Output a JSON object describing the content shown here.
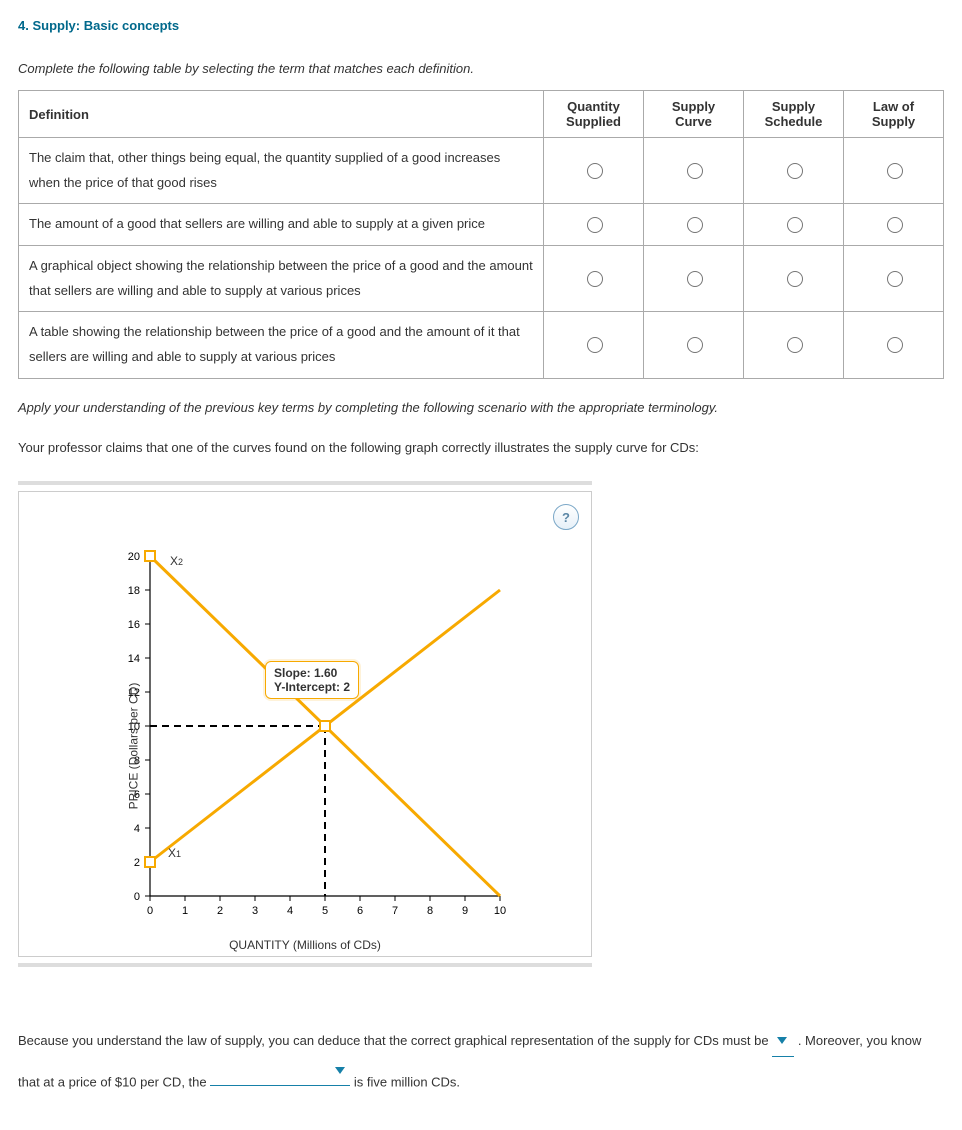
{
  "title": "4. Supply: Basic concepts",
  "instruction1": "Complete the following table by selecting the term that matches each definition.",
  "table": {
    "head_def": "Definition",
    "options": [
      "Quantity Supplied",
      "Supply Curve",
      "Supply Schedule",
      "Law of Supply"
    ],
    "rows": [
      "The claim that, other things being equal, the quantity supplied of a good increases when the price of that good rises",
      "The amount of a good that sellers are willing and able to supply at a given price",
      "A graphical object showing the relationship between the price of a good and the amount that sellers are willing and able to supply at various prices",
      "A table showing the relationship between the price of a good and the amount of it that sellers are willing and able to supply at various prices"
    ]
  },
  "instruction2": "Apply your understanding of the previous key terms by completing the following scenario with the appropriate terminology.",
  "scenario": "Your professor claims that one of the curves found on the following graph correctly illustrates the supply curve for CDs:",
  "help": "?",
  "chart_data": {
    "type": "line",
    "xlabel": "QUANTITY (Millions of CDs)",
    "ylabel": "PRICE (Dollars per CD)",
    "xlim": [
      0,
      10
    ],
    "ylim": [
      0,
      20
    ],
    "xticks": [
      0,
      1,
      2,
      3,
      4,
      5,
      6,
      7,
      8,
      9,
      10
    ],
    "yticks": [
      0,
      2,
      4,
      6,
      8,
      10,
      12,
      14,
      16,
      18,
      20
    ],
    "series": [
      {
        "name": "X1",
        "marker_at": [
          0,
          2
        ],
        "points": [
          [
            0,
            2
          ],
          [
            10,
            18
          ]
        ],
        "slope": 1.6,
        "y_intercept": 2
      },
      {
        "name": "X2",
        "marker_at": [
          0,
          20
        ],
        "points": [
          [
            0,
            20
          ],
          [
            10,
            0
          ]
        ]
      }
    ],
    "intersection": {
      "x": 5,
      "y": 10
    },
    "tooltip": {
      "slope_label": "Slope: 1.60",
      "yint_label": "Y-Intercept: 2"
    }
  },
  "closing": {
    "t1": "Because you understand the law of supply, you can deduce that the correct graphical representation of the supply for CDs must be ",
    "t2": " . Moreover, you know that at a price of $10 per CD, the ",
    "t3": " is five million CDs."
  }
}
